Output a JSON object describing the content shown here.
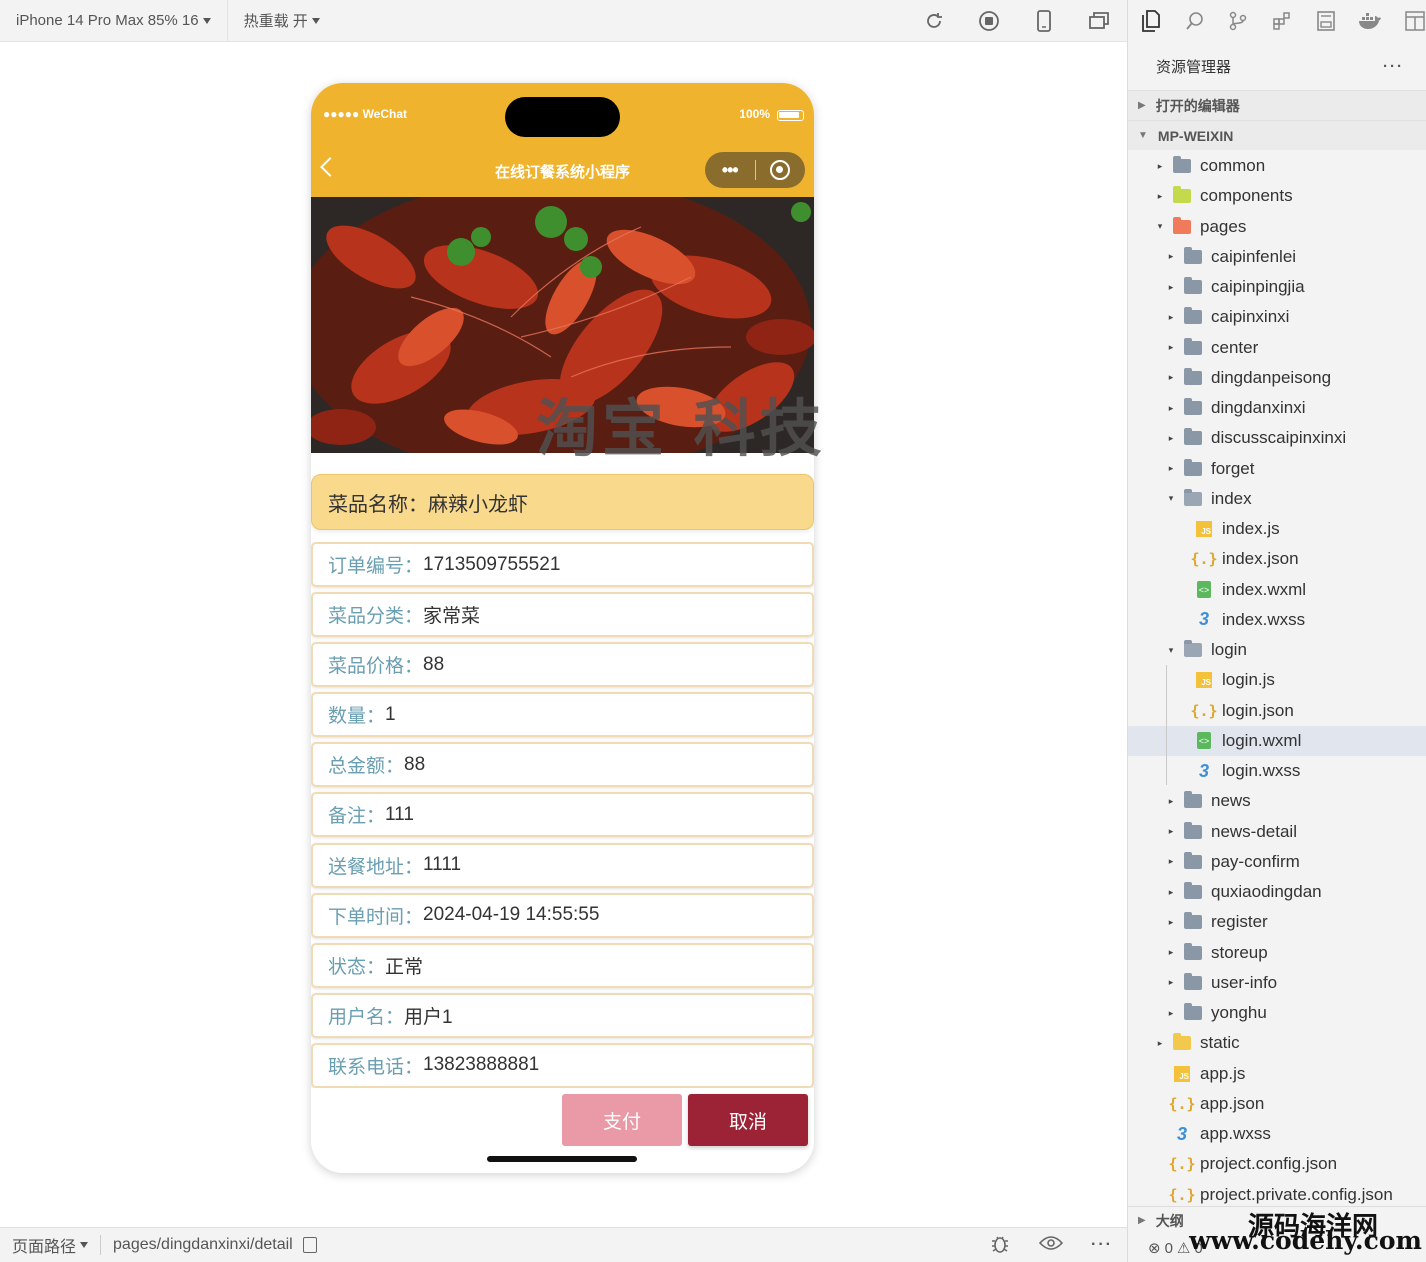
{
  "toolbar": {
    "device": "iPhone 14 Pro Max 85% 16",
    "hot_reload": "热重载 开"
  },
  "phone": {
    "carrier": "●●●●● WeChat",
    "battery": "100%",
    "nav_title": "在线订餐系统小程序",
    "capsule_dots": "•••",
    "dish_name_label": "菜品名称：",
    "dish_name": "麻辣小龙虾",
    "fields": [
      {
        "label": "订单编号：",
        "value": "1713509755521"
      },
      {
        "label": "菜品分类：",
        "value": "家常菜"
      },
      {
        "label": "菜品价格：",
        "value": "88"
      },
      {
        "label": "数量：",
        "value": "1"
      },
      {
        "label": "总金额：",
        "value": "88"
      },
      {
        "label": "备注：",
        "value": "111"
      },
      {
        "label": "送餐地址：",
        "value": "1111"
      },
      {
        "label": "下单时间：",
        "value": "2024-04-19 14:55:55"
      },
      {
        "label": "状态：",
        "value": "正常"
      },
      {
        "label": "用户名：",
        "value": "用户1"
      },
      {
        "label": "联系电话：",
        "value": "13823888881"
      }
    ],
    "pay_button": "支付",
    "cancel_button": "取消",
    "colors": {
      "header": "#f0b32e",
      "name_card": "#f9d98b",
      "label": "#6a9eb1",
      "pay": "#e99aa6",
      "cancel": "#9b2335"
    }
  },
  "watermark": "淘宝 科技",
  "explorer": {
    "title": "资源管理器",
    "more": "···",
    "open_editors": "打开的编辑器",
    "project": "MP-WEIXIN",
    "tree": [
      {
        "name": "common",
        "type": "folder",
        "arrow": "▸"
      },
      {
        "name": "components",
        "type": "folder-comp",
        "arrow": "▸"
      },
      {
        "name": "pages",
        "type": "folder-pages",
        "arrow": "▾"
      },
      {
        "name": "caipinfenlei",
        "type": "folder",
        "arrow": "▸"
      },
      {
        "name": "caipinpingjia",
        "type": "folder",
        "arrow": "▸"
      },
      {
        "name": "caipinxinxi",
        "type": "folder",
        "arrow": "▸"
      },
      {
        "name": "center",
        "type": "folder",
        "arrow": "▸"
      },
      {
        "name": "dingdanpeisong",
        "type": "folder",
        "arrow": "▸"
      },
      {
        "name": "dingdanxinxi",
        "type": "folder",
        "arrow": "▸"
      },
      {
        "name": "discusscaipinxinxi",
        "type": "folder",
        "arrow": "▸"
      },
      {
        "name": "forget",
        "type": "folder",
        "arrow": "▸"
      },
      {
        "name": "index",
        "type": "folder-open",
        "arrow": "▾"
      },
      {
        "name": "index.js",
        "type": "js",
        "arrow": ""
      },
      {
        "name": "index.json",
        "type": "json",
        "arrow": ""
      },
      {
        "name": "index.wxml",
        "type": "wxml",
        "arrow": ""
      },
      {
        "name": "index.wxss",
        "type": "wxss",
        "arrow": ""
      },
      {
        "name": "login",
        "type": "folder-open",
        "arrow": "▾"
      },
      {
        "name": "login.js",
        "type": "js",
        "arrow": ""
      },
      {
        "name": "login.json",
        "type": "json",
        "arrow": ""
      },
      {
        "name": "login.wxml",
        "type": "wxml",
        "arrow": "",
        "selected": true
      },
      {
        "name": "login.wxss",
        "type": "wxss",
        "arrow": ""
      },
      {
        "name": "news",
        "type": "folder",
        "arrow": "▸"
      },
      {
        "name": "news-detail",
        "type": "folder",
        "arrow": "▸"
      },
      {
        "name": "pay-confirm",
        "type": "folder",
        "arrow": "▸"
      },
      {
        "name": "quxiaodingdan",
        "type": "folder",
        "arrow": "▸"
      },
      {
        "name": "register",
        "type": "folder",
        "arrow": "▸"
      },
      {
        "name": "storeup",
        "type": "folder",
        "arrow": "▸"
      },
      {
        "name": "user-info",
        "type": "folder",
        "arrow": "▸"
      },
      {
        "name": "yonghu",
        "type": "folder",
        "arrow": "▸"
      },
      {
        "name": "static",
        "type": "folder-static",
        "arrow": "▸"
      },
      {
        "name": "app.js",
        "type": "js",
        "arrow": ""
      },
      {
        "name": "app.json",
        "type": "json",
        "arrow": ""
      },
      {
        "name": "app.wxss",
        "type": "wxss",
        "arrow": ""
      },
      {
        "name": "project.config.json",
        "type": "json",
        "arrow": ""
      },
      {
        "name": "project.private.config.json",
        "type": "json",
        "arrow": ""
      }
    ],
    "outline": "大纲",
    "errors": "0",
    "warnings": "0"
  },
  "statusbar": {
    "path_label": "页面路径",
    "path": "pages/dingdanxinxi/detail"
  },
  "site_watermark": {
    "line1": "源码海洋网",
    "line2": "www.codehy.com"
  }
}
